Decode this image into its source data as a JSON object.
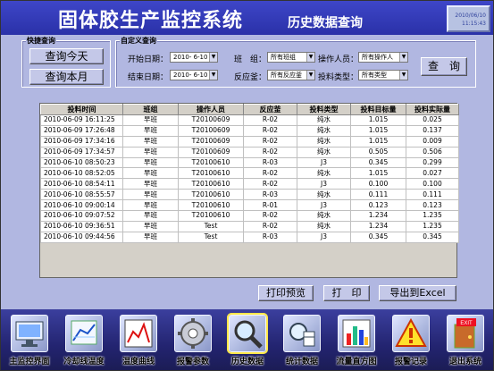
{
  "header": {
    "title": "固体胶生产监控系统",
    "subtitle": "历史数据查询",
    "clock_date": "2010/06/10",
    "clock_time": "11:15:43"
  },
  "quick_query": {
    "label": "快捷查询",
    "today_button": "查询今天",
    "month_button": "查询本月"
  },
  "custom_query": {
    "label": "自定义查询",
    "start_label": "开始日期：",
    "start_value": "2010- 6-10",
    "end_label": "结束日期：",
    "end_value": "2010- 6-10",
    "team_label": "班　组：",
    "team_value": "所有班组",
    "reactor_label": "反应釜：",
    "reactor_value": "所有反应釜",
    "operator_label": "操作人员：",
    "operator_value": "所有操作人",
    "type_label": "投料类型：",
    "type_value": "所有类型",
    "query_button": "查　询"
  },
  "table": {
    "columns": [
      "投料时间",
      "班组",
      "操作人员",
      "反应釜",
      "投料类型",
      "投料目标量",
      "投料实际量"
    ],
    "rows": [
      [
        "2010-06-09 16:11:25",
        "早班",
        "T20100609",
        "R-02",
        "纯水",
        "1.015",
        "0.025"
      ],
      [
        "2010-06-09 17:26:48",
        "早班",
        "T20100609",
        "R-02",
        "纯水",
        "1.015",
        "0.137"
      ],
      [
        "2010-06-09 17:34:16",
        "早班",
        "T20100609",
        "R-02",
        "纯水",
        "1.015",
        "0.009"
      ],
      [
        "2010-06-09 17:34:57",
        "早班",
        "T20100609",
        "R-02",
        "纯水",
        "0.505",
        "0.506"
      ],
      [
        "2010-06-10 08:50:23",
        "早班",
        "T20100610",
        "R-03",
        "J3",
        "0.345",
        "0.299"
      ],
      [
        "2010-06-10 08:52:05",
        "早班",
        "T20100610",
        "R-02",
        "纯水",
        "1.015",
        "0.027"
      ],
      [
        "2010-06-10 08:54:11",
        "早班",
        "T20100610",
        "R-02",
        "J3",
        "0.100",
        "0.100"
      ],
      [
        "2010-06-10 08:55:57",
        "早班",
        "T20100610",
        "R-03",
        "纯水",
        "0.111",
        "0.111"
      ],
      [
        "2010-06-10 09:00:14",
        "早班",
        "T20100610",
        "R-01",
        "J3",
        "0.123",
        "0.123"
      ],
      [
        "2010-06-10 09:07:52",
        "早班",
        "T20100610",
        "R-02",
        "纯水",
        "1.234",
        "1.235"
      ],
      [
        "2010-06-10 09:36:51",
        "早班",
        "Test",
        "R-02",
        "纯水",
        "1.234",
        "1.235"
      ],
      [
        "2010-06-10 09:44:56",
        "早班",
        "Test",
        "R-03",
        "J3",
        "0.345",
        "0.345"
      ]
    ]
  },
  "actions": {
    "print_preview": "打印预览",
    "print": "打　印",
    "export": "导出到Excel"
  },
  "nav": [
    {
      "label": "主监控界面",
      "icon": "monitor-icon"
    },
    {
      "label": "冷却线温度",
      "icon": "thermometer-icon"
    },
    {
      "label": "温度曲线",
      "icon": "line-chart-icon"
    },
    {
      "label": "报警参数",
      "icon": "gear-icon"
    },
    {
      "label": "历史数据",
      "icon": "magnifier-icon"
    },
    {
      "label": "统计数据",
      "icon": "statistics-icon"
    },
    {
      "label": "流量直方图",
      "icon": "histogram-icon"
    },
    {
      "label": "报警记录",
      "icon": "warning-icon"
    },
    {
      "label": "退出系统",
      "icon": "exit-icon"
    }
  ]
}
